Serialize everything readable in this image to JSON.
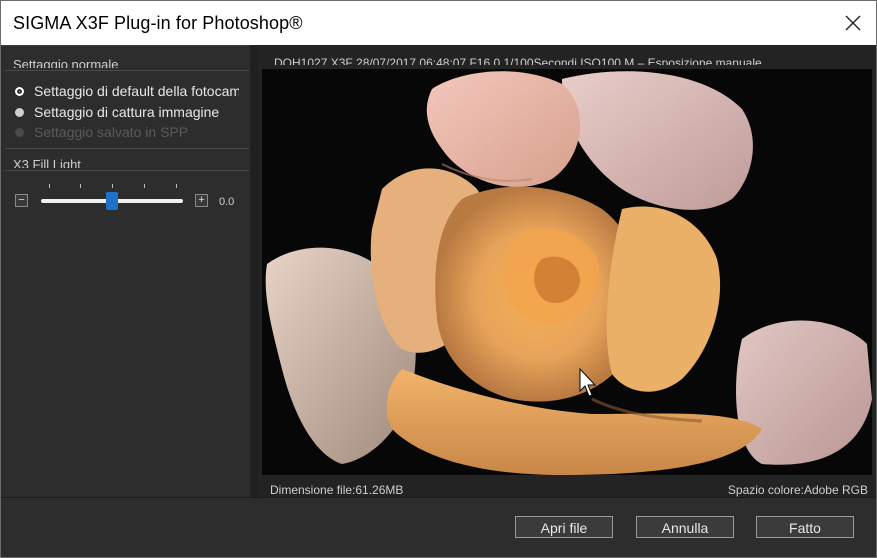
{
  "window": {
    "title": "SIGMA X3F Plug-in for Photoshop®",
    "close_icon": "close-icon"
  },
  "settings": {
    "section_title": "Settaggio normale",
    "options": [
      {
        "label": "Settaggio di default della fotocamera",
        "state": "selected"
      },
      {
        "label": "Settaggio di cattura immagine",
        "state": "normal"
      },
      {
        "label": "Settaggio salvato in SPP",
        "state": "disabled"
      }
    ]
  },
  "fill_light": {
    "section_title": "X3 Fill Light",
    "minus_label": "−",
    "plus_label": "+",
    "value": "0.0",
    "level_fraction": 0.5
  },
  "preview": {
    "info_top": "DQH1027.X3F  28/07/2017 06:48:07  F16.0  1/100Secondi  ISO100  M – Esposizione manuale",
    "file_size": "Dimensione file:61.26MB",
    "color_space": "Spazio colore:Adobe RGB"
  },
  "buttons": {
    "open": "Apri file",
    "cancel": "Annulla",
    "done": "Fatto"
  },
  "colors": {
    "accent": "#1e73c8",
    "background": "#2b2b2b"
  }
}
